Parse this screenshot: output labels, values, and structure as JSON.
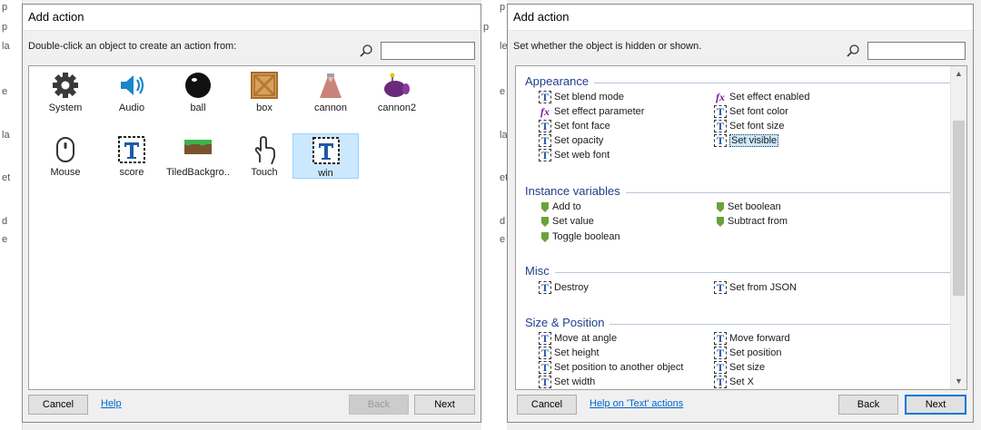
{
  "background": {
    "left_fragments": [
      "p",
      "p",
      "la",
      "e",
      "la",
      "et",
      "d",
      "e"
    ],
    "mid_fragments": [
      "p",
      "p",
      "le",
      "e",
      "la",
      "et",
      "d",
      "e"
    ]
  },
  "dialog_left": {
    "title": "Add action",
    "description": "Double-click an object to create an action from:",
    "search": {
      "value": "",
      "placeholder": ""
    },
    "objects": [
      {
        "label": "System",
        "icon": "gear-icon"
      },
      {
        "label": "Audio",
        "icon": "speaker-icon"
      },
      {
        "label": "ball",
        "icon": "ball-icon"
      },
      {
        "label": "box",
        "icon": "box-icon"
      },
      {
        "label": "cannon",
        "icon": "cannon-icon"
      },
      {
        "label": "cannon2",
        "icon": "cannon2-icon"
      },
      {
        "label": "Mouse",
        "icon": "mouse-icon"
      },
      {
        "label": "score",
        "icon": "text-icon"
      },
      {
        "label": "TiledBackgro...",
        "icon": "tiled-background-icon"
      },
      {
        "label": "Touch",
        "icon": "touch-icon"
      },
      {
        "label": "win",
        "icon": "text-icon",
        "selected": true
      }
    ],
    "buttons": {
      "cancel": "Cancel",
      "help": "Help",
      "back": "Back",
      "next": "Next"
    }
  },
  "dialog_right": {
    "title": "Add action",
    "description": "Set whether the object is hidden or shown.",
    "search": {
      "value": "",
      "placeholder": ""
    },
    "groups": [
      {
        "title": "Appearance",
        "actions": [
          {
            "label": "Set blend mode",
            "icon": "text-icon"
          },
          {
            "label": "Set effect enabled",
            "icon": "fx-icon"
          },
          {
            "label": "Set effect parameter",
            "icon": "fx-icon"
          },
          {
            "label": "Set font color",
            "icon": "text-icon"
          },
          {
            "label": "Set font face",
            "icon": "text-icon"
          },
          {
            "label": "Set font size",
            "icon": "text-icon"
          },
          {
            "label": "Set opacity",
            "icon": "text-icon"
          },
          {
            "label": "Set visible",
            "icon": "text-icon",
            "selected": true
          },
          {
            "label": "Set web font",
            "icon": "text-icon"
          }
        ]
      },
      {
        "title": "Instance variables",
        "actions": [
          {
            "label": "Add to",
            "icon": "variable-icon"
          },
          {
            "label": "Set boolean",
            "icon": "variable-icon"
          },
          {
            "label": "Set value",
            "icon": "variable-icon"
          },
          {
            "label": "Subtract from",
            "icon": "variable-icon"
          },
          {
            "label": "Toggle boolean",
            "icon": "variable-icon"
          }
        ]
      },
      {
        "title": "Misc",
        "actions": [
          {
            "label": "Destroy",
            "icon": "text-icon"
          },
          {
            "label": "Set from JSON",
            "icon": "text-icon"
          }
        ]
      },
      {
        "title": "Size & Position",
        "actions": [
          {
            "label": "Move at angle",
            "icon": "text-icon"
          },
          {
            "label": "Move forward",
            "icon": "text-icon"
          },
          {
            "label": "Set height",
            "icon": "text-icon"
          },
          {
            "label": "Set position",
            "icon": "text-icon"
          },
          {
            "label": "Set position to another object",
            "icon": "text-icon"
          },
          {
            "label": "Set size",
            "icon": "text-icon"
          },
          {
            "label": "Set width",
            "icon": "text-icon"
          },
          {
            "label": "Set X",
            "icon": "text-icon"
          }
        ]
      }
    ],
    "buttons": {
      "cancel": "Cancel",
      "help": "Help on 'Text' actions",
      "back": "Back",
      "next": "Next"
    }
  },
  "colors": {
    "accent": "#0078d7",
    "selection": "#cce8ff",
    "group_title": "#1e3f8c",
    "link": "#0066cc"
  }
}
